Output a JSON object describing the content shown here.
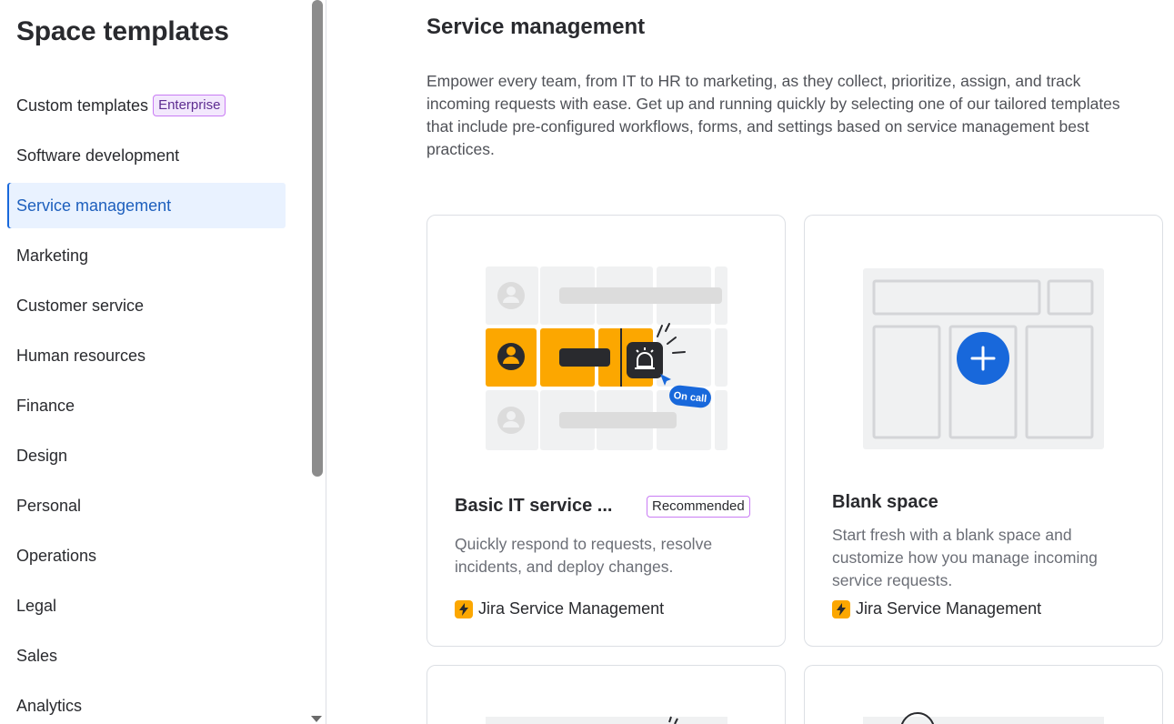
{
  "sidebar": {
    "title": "Space templates",
    "items": [
      {
        "label": "Custom templates",
        "badge": "Enterprise"
      },
      {
        "label": "Software development"
      },
      {
        "label": "Service management",
        "active": true
      },
      {
        "label": "Marketing"
      },
      {
        "label": "Customer service"
      },
      {
        "label": "Human resources"
      },
      {
        "label": "Finance"
      },
      {
        "label": "Design"
      },
      {
        "label": "Personal"
      },
      {
        "label": "Operations"
      },
      {
        "label": "Legal"
      },
      {
        "label": "Sales"
      },
      {
        "label": "Analytics"
      }
    ]
  },
  "main": {
    "title": "Service management",
    "description": "Empower every team, from IT to HR to marketing, as they collect, prioritize, assign, and track incoming requests with ease. Get up and running quickly by selecting one of our tailored templates that include pre-configured workflows, forms, and settings based on service management best practices.",
    "cards": [
      {
        "title": "Basic IT service ...",
        "badge": "Recommended",
        "description": "Quickly respond to requests, resolve incidents, and deploy changes.",
        "product": "Jira Service Management",
        "illustration_label": "On call"
      },
      {
        "title": "Blank space",
        "description": "Start fresh with a blank space and customize how you manage incoming service requests.",
        "product": "Jira Service Management"
      }
    ]
  },
  "colors": {
    "accent": "#1868db",
    "active_bg": "#e9f2ff",
    "highlight_yellow": "#fca700",
    "lozenge_border": "#c97cf4"
  },
  "icons": [
    "avatar-icon",
    "siren-icon",
    "cursor-icon",
    "plus-icon",
    "lightning-icon"
  ]
}
